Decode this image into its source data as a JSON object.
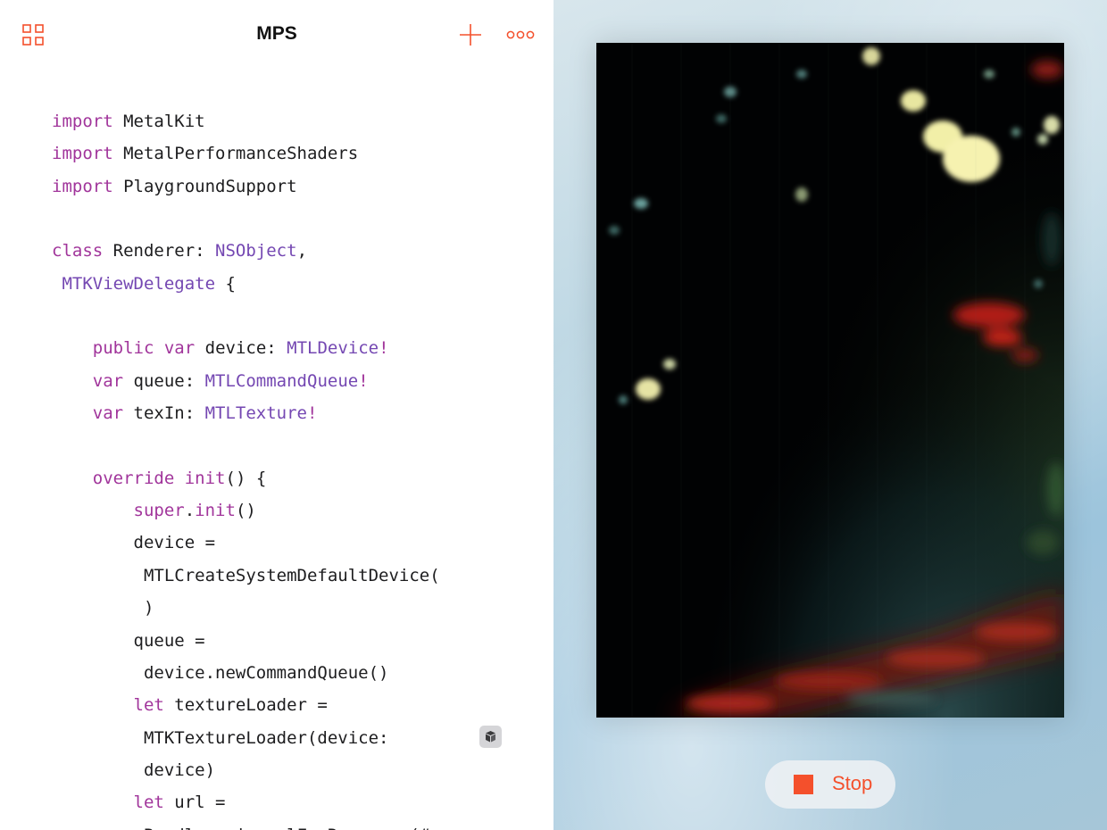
{
  "navbar": {
    "title": "MPS",
    "grid_icon": "grid-icon",
    "add_icon": "plus-icon",
    "more_icon": "ellipsis-icon",
    "accent_color": "#f4502c"
  },
  "code": {
    "lines": [
      [
        {
          "t": "import",
          "c": "kw"
        },
        {
          "t": " MetalKit",
          "c": "pl"
        }
      ],
      [
        {
          "t": "import",
          "c": "kw"
        },
        {
          "t": " MetalPerformanceShaders",
          "c": "pl"
        }
      ],
      [
        {
          "t": "import",
          "c": "kw"
        },
        {
          "t": " PlaygroundSupport",
          "c": "pl"
        }
      ],
      [],
      [
        {
          "t": "class",
          "c": "kw"
        },
        {
          "t": " Renderer: ",
          "c": "pl"
        },
        {
          "t": "NSObject",
          "c": "ty"
        },
        {
          "t": ",",
          "c": "pl"
        }
      ],
      [
        {
          "t": " ",
          "c": "pl"
        },
        {
          "t": "MTKViewDelegate",
          "c": "ty"
        },
        {
          "t": " {",
          "c": "pl"
        }
      ],
      [],
      [
        {
          "t": "    ",
          "c": "pl"
        },
        {
          "t": "public",
          "c": "kw"
        },
        {
          "t": " ",
          "c": "pl"
        },
        {
          "t": "var",
          "c": "kw"
        },
        {
          "t": " device: ",
          "c": "pl"
        },
        {
          "t": "MTLDevice",
          "c": "ty"
        },
        {
          "t": "!",
          "c": "kw"
        }
      ],
      [
        {
          "t": "    ",
          "c": "pl"
        },
        {
          "t": "var",
          "c": "kw"
        },
        {
          "t": " queue: ",
          "c": "pl"
        },
        {
          "t": "MTLCommandQueue",
          "c": "ty"
        },
        {
          "t": "!",
          "c": "kw"
        }
      ],
      [
        {
          "t": "    ",
          "c": "pl"
        },
        {
          "t": "var",
          "c": "kw"
        },
        {
          "t": " texIn: ",
          "c": "pl"
        },
        {
          "t": "MTLTexture",
          "c": "ty"
        },
        {
          "t": "!",
          "c": "kw"
        }
      ],
      [],
      [
        {
          "t": "    ",
          "c": "pl"
        },
        {
          "t": "override",
          "c": "kw"
        },
        {
          "t": " ",
          "c": "pl"
        },
        {
          "t": "init",
          "c": "kw"
        },
        {
          "t": "() {",
          "c": "pl"
        }
      ],
      [
        {
          "t": "        ",
          "c": "pl"
        },
        {
          "t": "super",
          "c": "kw"
        },
        {
          "t": ".",
          "c": "pl"
        },
        {
          "t": "init",
          "c": "kw"
        },
        {
          "t": "()",
          "c": "pl"
        }
      ],
      [
        {
          "t": "        device =",
          "c": "pl"
        }
      ],
      [
        {
          "t": "         MTLCreateSystemDefaultDevice(",
          "c": "pl"
        }
      ],
      [
        {
          "t": "         )",
          "c": "pl"
        }
      ],
      [
        {
          "t": "        queue =",
          "c": "pl"
        }
      ],
      [
        {
          "t": "         device.newCommandQueue()",
          "c": "pl"
        }
      ],
      [
        {
          "t": "        ",
          "c": "pl"
        },
        {
          "t": "let",
          "c": "kw"
        },
        {
          "t": " textureLoader =",
          "c": "pl"
        }
      ],
      [
        {
          "t": "         MTKTextureLoader(device:",
          "c": "pl"
        }
      ],
      [
        {
          "t": "         device)",
          "c": "pl"
        }
      ],
      [
        {
          "t": "        ",
          "c": "pl"
        },
        {
          "t": "let",
          "c": "kw"
        },
        {
          "t": " url =",
          "c": "pl"
        }
      ],
      [
        {
          "t": "         Bundle.main.urlForResource(#",
          "c": "pl"
        }
      ]
    ],
    "keyword_color": "#a1359b",
    "type_color": "#7447b2",
    "literal_icon": "cube-icon"
  },
  "liveview": {
    "stop_label": "Stop",
    "stop_icon": "stop-square-icon"
  }
}
